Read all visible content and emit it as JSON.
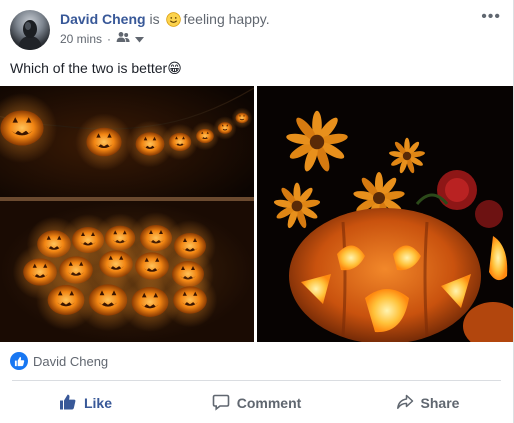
{
  "post": {
    "author": "David Cheng",
    "verb": "is",
    "feeling": "feeling happy.",
    "time": "20 mins",
    "meta_sep": "·",
    "more": "•••",
    "text": "Which of the two is better",
    "text_emoji": "😁"
  },
  "reactions": {
    "names": "David Cheng",
    "icon": "like-icon",
    "color": "#1877f2"
  },
  "actions": [
    {
      "label": "Like",
      "icon": "thumbs-up-icon"
    },
    {
      "label": "Comment",
      "icon": "comment-icon"
    },
    {
      "label": "Share",
      "icon": "share-icon"
    }
  ],
  "colors": {
    "author": "#385898",
    "muted": "#616770",
    "pumpkin": "#f08a1c"
  }
}
